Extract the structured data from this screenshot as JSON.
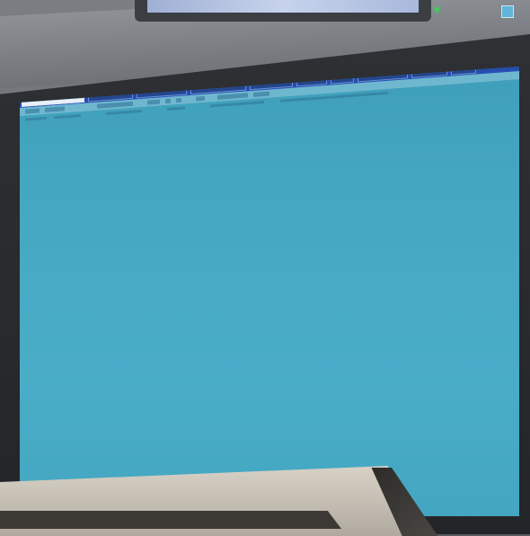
{
  "scene": {
    "description_visible_text": ""
  },
  "screen": {
    "background_color": "#46a7c2",
    "tabs": [
      "",
      "",
      "",
      "",
      "",
      "",
      "",
      "",
      "",
      "",
      ""
    ],
    "active_tab_index": 0
  },
  "colors": {
    "tabbar": "#2a52b8",
    "screen": "#46a7c2",
    "bezel": "#2a2c30",
    "led": "#38d35a"
  },
  "icons": {
    "corner": "window-control-icon",
    "status_led": "power-led-icon"
  }
}
